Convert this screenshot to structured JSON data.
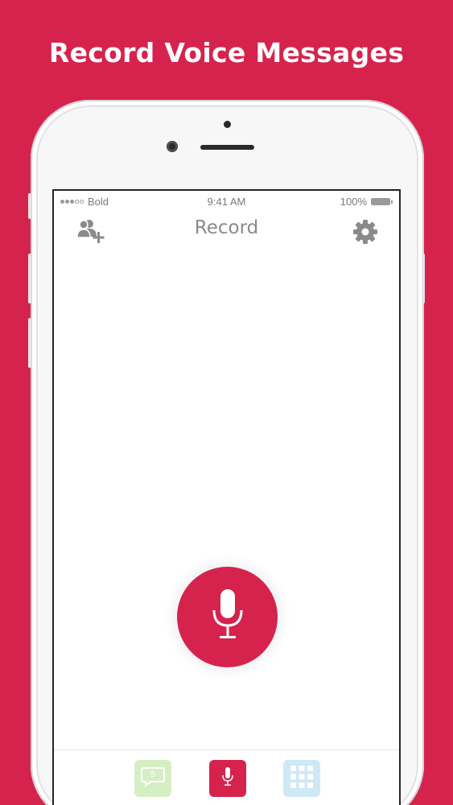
{
  "headline": "Record Voice Messages",
  "status_bar": {
    "carrier": "Bold",
    "signal_bars_filled": 3,
    "signal_bars_total": 5,
    "time": "9:41 AM",
    "battery": "100%"
  },
  "nav": {
    "title": "Record",
    "left_icon": "add-contact-icon",
    "right_icon": "gear-icon"
  },
  "record_button": {
    "icon": "microphone-icon"
  },
  "tab_bar": {
    "tabs": [
      {
        "icon": "message-bubble-icon",
        "badge_label": "5",
        "color": "#d6eec4"
      },
      {
        "icon": "microphone-icon",
        "color": "#d6234e",
        "selected": true
      },
      {
        "icon": "grid-icon",
        "color": "#cfe8f5"
      }
    ]
  },
  "colors": {
    "brand": "#d6234e",
    "title_gray": "#8a8a8a"
  }
}
